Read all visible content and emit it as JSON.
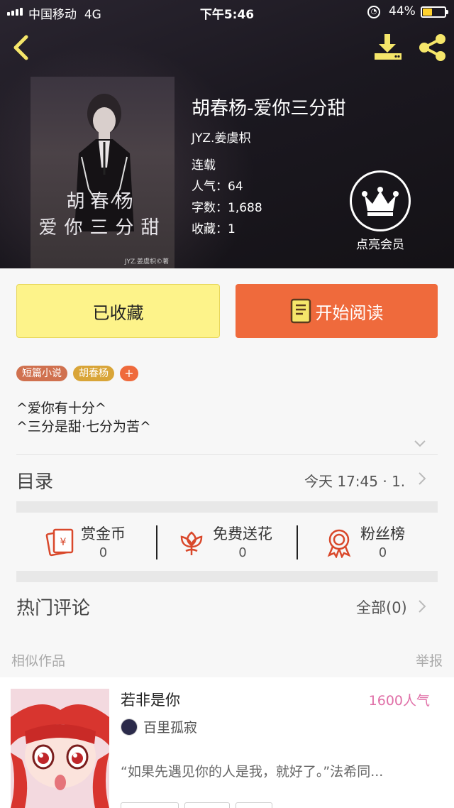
{
  "status_bar": {
    "carrier": "中国移动",
    "network": "4G",
    "time": "下午5:46",
    "battery": "44%",
    "battery_level": 0.44
  },
  "book": {
    "title": "胡春杨-爱你三分甜",
    "author": "JYZ.姜虞枳",
    "status": "连载",
    "popularity": "人气：64",
    "word_count": "字数：1,688",
    "favorites": "收藏：1"
  },
  "vip": {
    "label": "点亮会员"
  },
  "actions": {
    "collected_label": "已收藏",
    "read_label": "开始阅读"
  },
  "tags": [
    {
      "label": "短篇小说"
    },
    {
      "label": "胡春杨"
    },
    {
      "label": "+"
    }
  ],
  "description": {
    "line1": "^爱你有十分^",
    "line2": "^三分是甜·七分为苦^"
  },
  "toc": {
    "title": "目录",
    "latest": "今天 17:45 · 1."
  },
  "stats": [
    {
      "name": "赏金币",
      "value": "0"
    },
    {
      "name": "免费送花",
      "value": "0"
    },
    {
      "name": "粉丝榜",
      "value": "0"
    }
  ],
  "comments": {
    "title": "热门评论",
    "all_label": "全部(0)"
  },
  "similar": {
    "title": "相似作品",
    "report_label": "举报"
  },
  "recommendation": {
    "title": "若非是你",
    "popularity": "1600人气",
    "author": "百里孤寂",
    "quote": "“如果先遇见你的人是我，就好了。”法希同..."
  },
  "colors": {
    "collected_bg": "#fdf38a",
    "read_bg": "#ef6a3c",
    "accent_red": "#d9482b",
    "popularity_pink": "#e06fa7"
  }
}
